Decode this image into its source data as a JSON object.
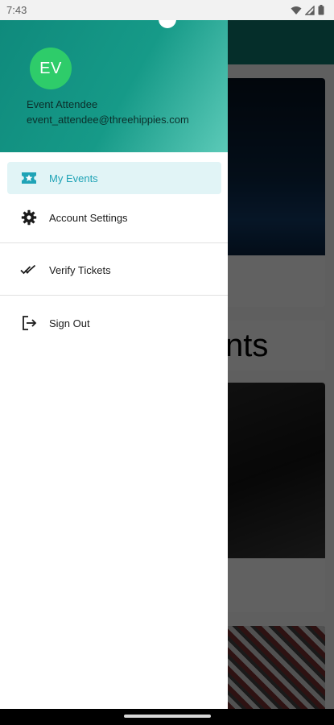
{
  "status_bar": {
    "time": "7:43",
    "icons": [
      "wifi-icon",
      "signal-icon",
      "battery-icon"
    ]
  },
  "drawer": {
    "avatar_initials": "EV",
    "user_name": "Event Attendee",
    "user_email": "event_attendee@threehippies.com",
    "items": [
      {
        "label": "My Events",
        "icon": "ticket-star-icon",
        "active": true
      },
      {
        "label": "Account Settings",
        "icon": "gear-icon",
        "active": false
      },
      {
        "label": "Verify Tickets",
        "icon": "double-check-icon",
        "active": false
      },
      {
        "label": "Sign Out",
        "icon": "sign-out-icon",
        "active": false
      }
    ]
  },
  "background": {
    "heading_fragment": "nts"
  },
  "colors": {
    "header_gradient_start": "#0f8a7c",
    "header_gradient_end": "#5ccab8",
    "avatar": "#2ecc6a",
    "active_item_bg": "#e1f4f6",
    "active_item_text": "#1fa3b6"
  }
}
